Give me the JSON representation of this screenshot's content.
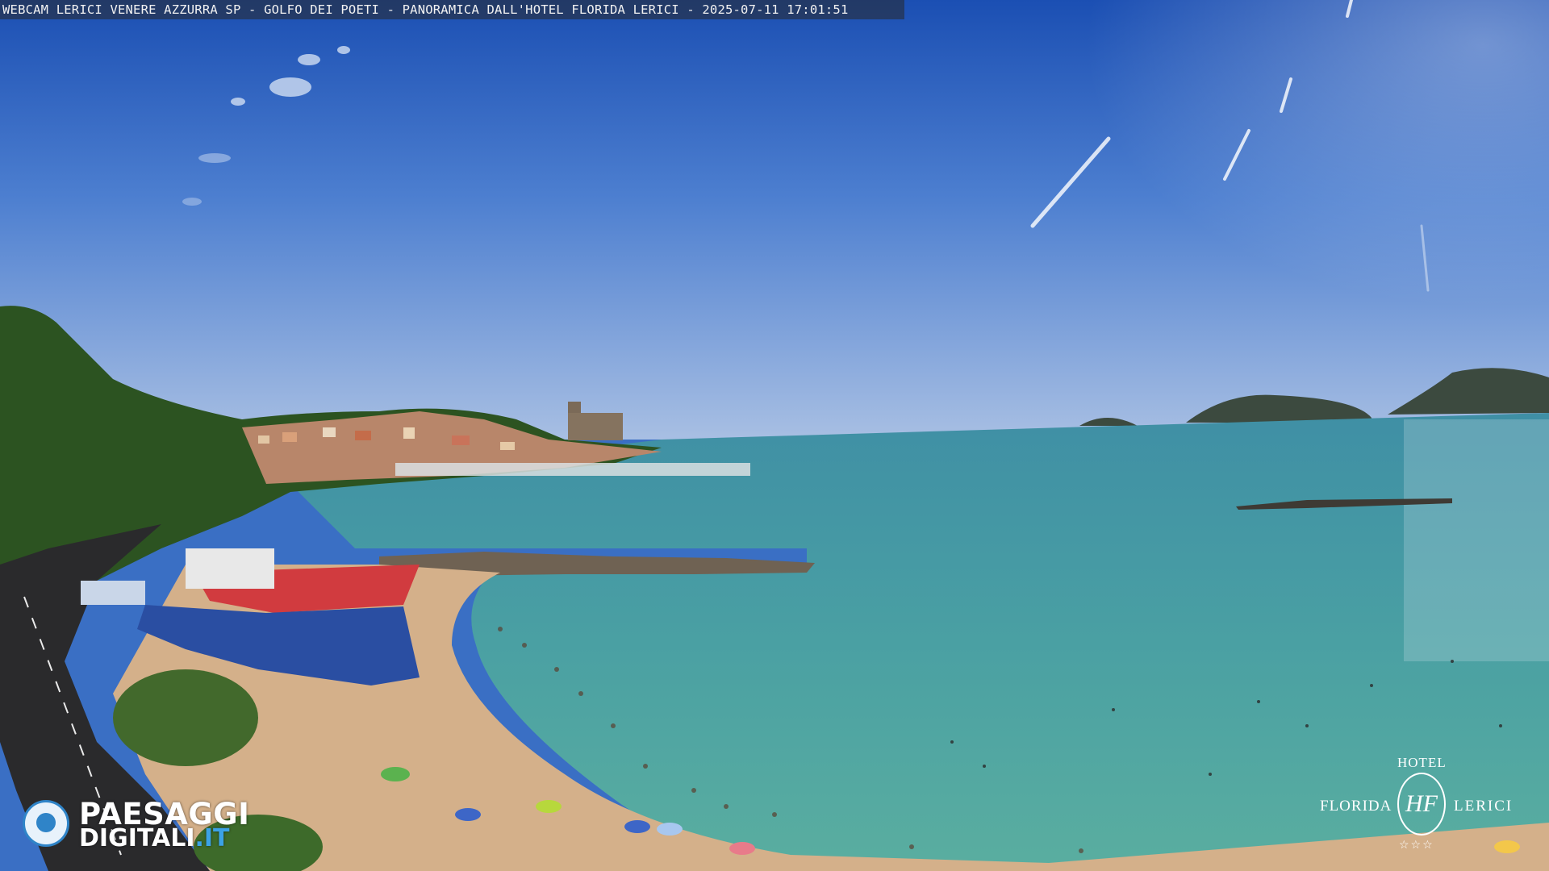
{
  "caption": {
    "text": "WEBCAM LERICI VENERE AZZURRA SP - GOLFO DEI POETI - PANORAMICA DALL'HOTEL FLORIDA LERICI - 2025-07-11 17:01:51"
  },
  "watermark_left": {
    "line1": "PAESAGGI",
    "line2_main": "DIGITALI",
    "line2_tld": ".IT"
  },
  "watermark_right": {
    "hotel": "HOTEL",
    "florida": "FLORIDA",
    "lerici": "LERICI",
    "monogram": "HF",
    "stars": "☆☆☆"
  },
  "colors": {
    "sky_top": "#1d52b6",
    "sky_horizon": "#9fb8e0",
    "sea": "#4a9fa6",
    "sand": "#d8b48a",
    "hill": "#2f5a23"
  }
}
